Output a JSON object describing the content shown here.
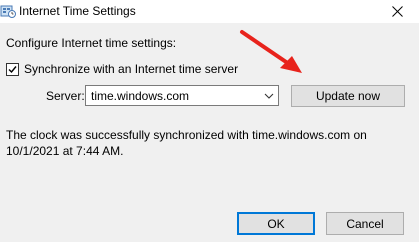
{
  "window": {
    "title": "Internet Time Settings",
    "icon": "clock-settings-icon"
  },
  "header_label": "Configure Internet time settings:",
  "sync_checkbox": {
    "label": "Synchronize with an Internet time server",
    "checked": true
  },
  "server": {
    "label": "Server:",
    "value": "time.windows.com"
  },
  "buttons": {
    "update": "Update now",
    "ok": "OK",
    "cancel": "Cancel"
  },
  "status_message": "The clock was successfully synchronized with time.windows.com on 10/1/2021 at 7:44 AM.",
  "annotation": {
    "arrow_color": "#e8231c"
  }
}
